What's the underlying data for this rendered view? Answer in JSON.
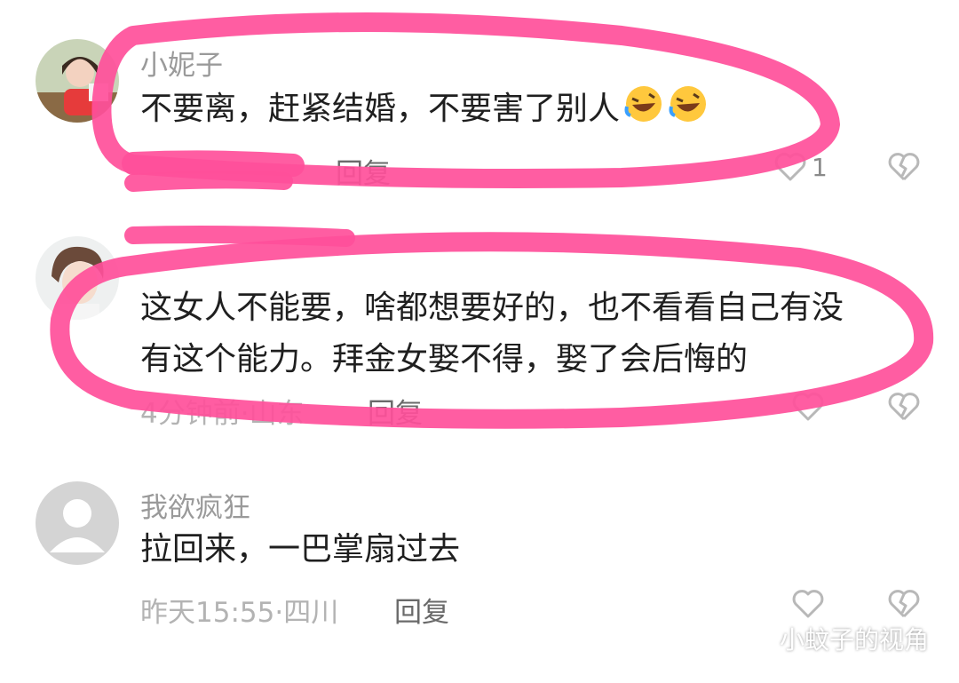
{
  "comments": [
    {
      "username": "小妮子",
      "text": "不要离，赶紧结婚，不要害了别人",
      "emoji": "rolling-on-floor-laughing",
      "meta": "",
      "reply": "回复",
      "likes": "1"
    },
    {
      "username": "",
      "text_line1": "这女人不能要，啥都想要好的，也不看看自己有没",
      "text_line2": "有这个能力。拜金女娶不得，娶了会后悔的",
      "meta": "4分钟前·山东",
      "reply": "回复",
      "likes": ""
    },
    {
      "username": "我欲疯狂",
      "text": "拉回来，一巴掌扇过去",
      "meta": "昨天15:55·四川",
      "reply": "回复",
      "likes": ""
    }
  ],
  "watermark": "小蚊子的视角",
  "colors": {
    "highlight": "#ff4f9a",
    "meta_gray": "#b3b3b3"
  }
}
